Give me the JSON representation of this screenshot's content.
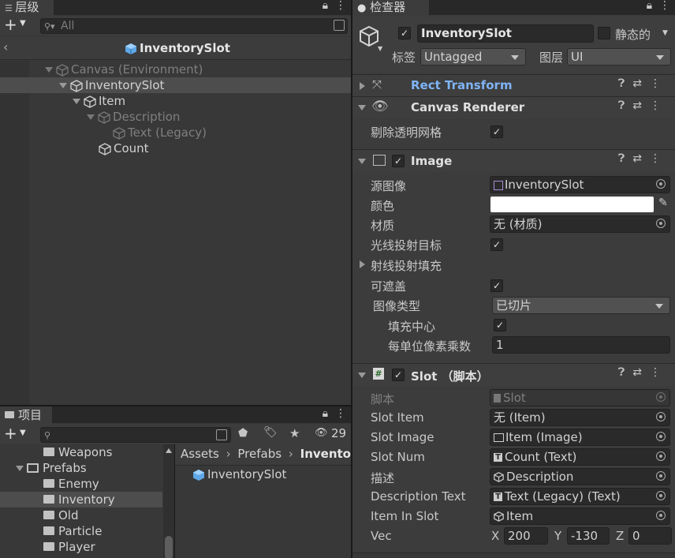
{
  "hierarchy": {
    "tab_label": "层级",
    "search_placeholder": "All",
    "prefab_title": "InventorySlot",
    "tree": [
      {
        "label": "Canvas (Environment)",
        "dim": true
      },
      {
        "label": "InventorySlot",
        "dim": false
      },
      {
        "label": "Item",
        "dim": false
      },
      {
        "label": "Description",
        "dim": true
      },
      {
        "label": "Text (Legacy)",
        "dim": true
      },
      {
        "label": "Count",
        "dim": false
      }
    ]
  },
  "project": {
    "tab_label": "项目",
    "hidden_count": "29",
    "folders": [
      "Weapons",
      "Prefabs",
      "Enemy",
      "Inventory",
      "Old",
      "Particle",
      "Player"
    ],
    "breadcrumb": [
      "Assets",
      "Prefabs",
      "Inventor"
    ],
    "asset": "InventorySlot"
  },
  "inspector": {
    "tab_label": "检查器",
    "object_name": "InventorySlot",
    "static_label": "静态的",
    "tag_label": "标签",
    "tag_value": "Untagged",
    "layer_label": "图层",
    "layer_value": "UI",
    "rect_transform": "Rect Transform",
    "canvas_renderer": {
      "title": "Canvas Renderer",
      "cull_label": "剔除透明网格"
    },
    "image": {
      "title": "Image",
      "source_label": "源图像",
      "source_value": "InventorySlot",
      "color_label": "颜色",
      "material_label": "材质",
      "material_value": "无 (材质)",
      "raycast_target_label": "光线投射目标",
      "raycast_padding_label": "射线投射填充",
      "maskable_label": "可遮盖",
      "image_type_label": "图像类型",
      "image_type_value": "已切片",
      "fill_center_label": "填充中心",
      "ppu_label": "每单位像素乘数",
      "ppu_value": "1"
    },
    "slot": {
      "title": "Slot （脚本）",
      "script_label": "脚本",
      "script_value": "Slot",
      "slot_item_label": "Slot Item",
      "slot_item_value": "无 (Item)",
      "slot_image_label": "Slot Image",
      "slot_image_value": "Item (Image)",
      "slot_num_label": "Slot Num",
      "slot_num_value": "Count (Text)",
      "desc_label": "描述",
      "desc_value": "Description",
      "desc_text_label": "Description Text",
      "desc_text_value": "Text (Legacy) (Text)",
      "item_in_slot_label": "Item In Slot",
      "item_in_slot_value": "Item",
      "vec_label": "Vec",
      "vec_x_label": "X",
      "vec_x": "200",
      "vec_y_label": "Y",
      "vec_y": "-130",
      "vec_z_label": "Z",
      "vec_z": "0"
    }
  },
  "colors": {
    "accent_blue": "#7fb4f5",
    "panel": "#383838",
    "field": "#2a2a2a"
  }
}
